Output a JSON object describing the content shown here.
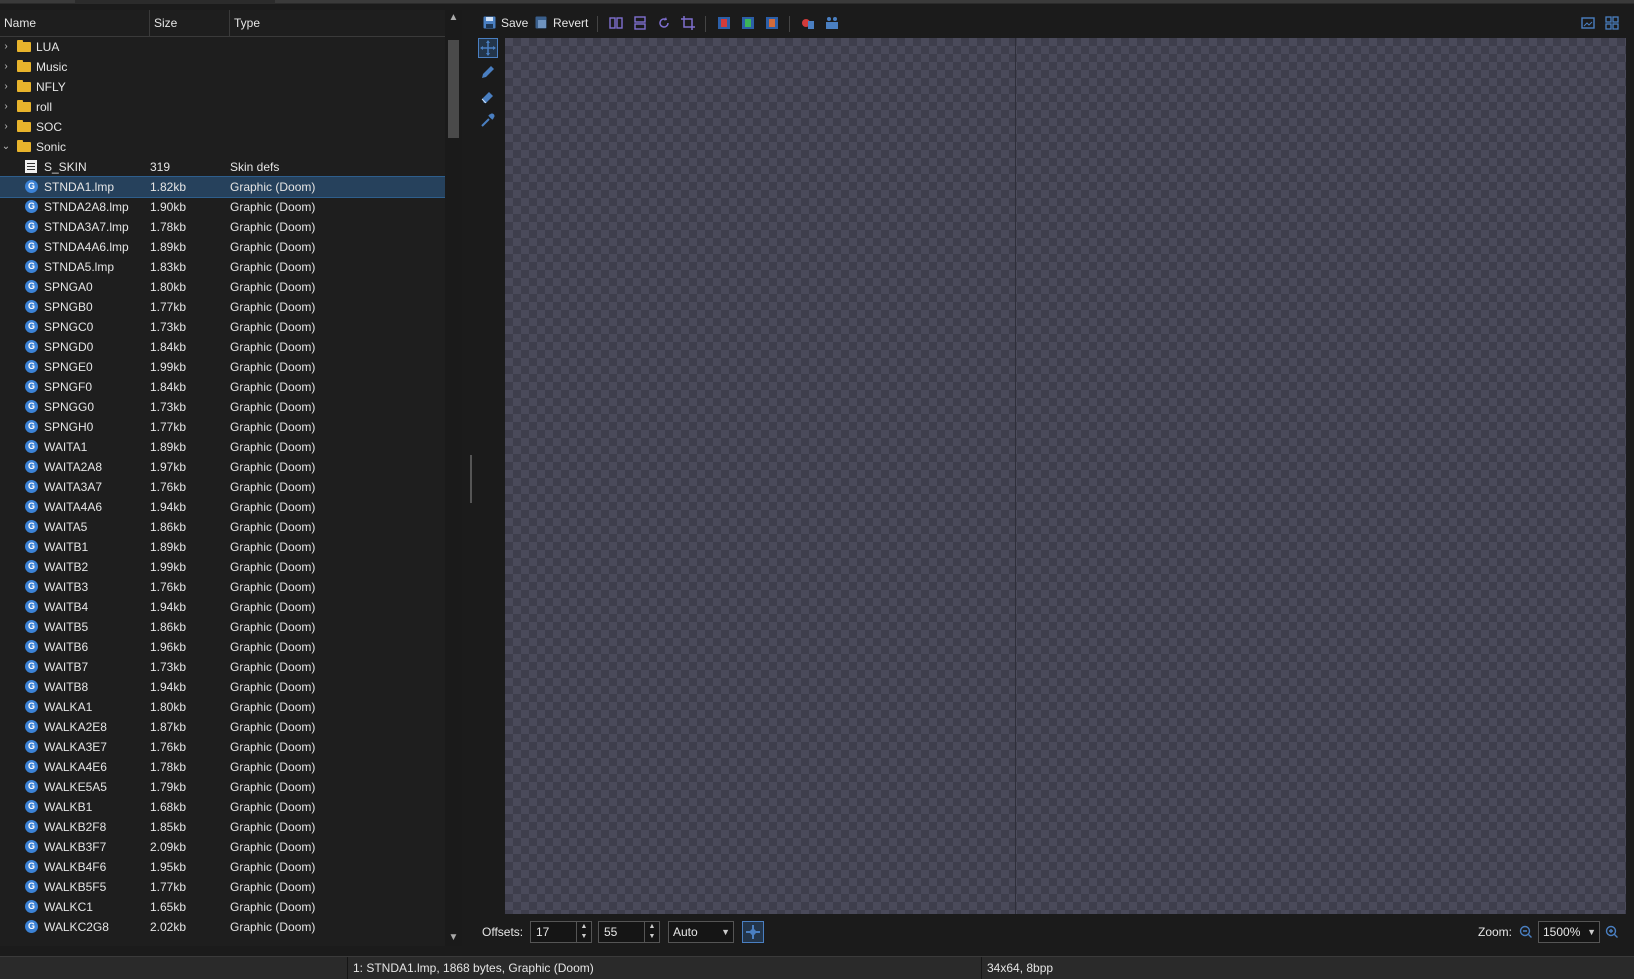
{
  "columns": {
    "name": "Name",
    "size": "Size",
    "type": "Type"
  },
  "tree": [
    {
      "kind": "folder",
      "expanded": false,
      "name": "LUA",
      "size": "",
      "type": ""
    },
    {
      "kind": "folder",
      "expanded": false,
      "name": "Music",
      "size": "",
      "type": ""
    },
    {
      "kind": "folder",
      "expanded": false,
      "name": "NFLY",
      "size": "",
      "type": ""
    },
    {
      "kind": "folder",
      "expanded": false,
      "name": "roll",
      "size": "",
      "type": ""
    },
    {
      "kind": "folder",
      "expanded": false,
      "name": "SOC",
      "size": "",
      "type": ""
    },
    {
      "kind": "folder",
      "expanded": true,
      "name": "Sonic",
      "size": "",
      "type": ""
    },
    {
      "kind": "text",
      "name": "S_SKIN",
      "size": "319",
      "type": "Skin defs"
    },
    {
      "kind": "graphic",
      "selected": true,
      "name": "STNDA1.lmp",
      "size": "1.82kb",
      "type": "Graphic (Doom)"
    },
    {
      "kind": "graphic",
      "name": "STNDA2A8.lmp",
      "size": "1.90kb",
      "type": "Graphic (Doom)"
    },
    {
      "kind": "graphic",
      "name": "STNDA3A7.lmp",
      "size": "1.78kb",
      "type": "Graphic (Doom)"
    },
    {
      "kind": "graphic",
      "name": "STNDA4A6.lmp",
      "size": "1.89kb",
      "type": "Graphic (Doom)"
    },
    {
      "kind": "graphic",
      "name": "STNDA5.lmp",
      "size": "1.83kb",
      "type": "Graphic (Doom)"
    },
    {
      "kind": "graphic",
      "name": "SPNGA0",
      "size": "1.80kb",
      "type": "Graphic (Doom)"
    },
    {
      "kind": "graphic",
      "name": "SPNGB0",
      "size": "1.77kb",
      "type": "Graphic (Doom)"
    },
    {
      "kind": "graphic",
      "name": "SPNGC0",
      "size": "1.73kb",
      "type": "Graphic (Doom)"
    },
    {
      "kind": "graphic",
      "name": "SPNGD0",
      "size": "1.84kb",
      "type": "Graphic (Doom)"
    },
    {
      "kind": "graphic",
      "name": "SPNGE0",
      "size": "1.99kb",
      "type": "Graphic (Doom)"
    },
    {
      "kind": "graphic",
      "name": "SPNGF0",
      "size": "1.84kb",
      "type": "Graphic (Doom)"
    },
    {
      "kind": "graphic",
      "name": "SPNGG0",
      "size": "1.73kb",
      "type": "Graphic (Doom)"
    },
    {
      "kind": "graphic",
      "name": "SPNGH0",
      "size": "1.77kb",
      "type": "Graphic (Doom)"
    },
    {
      "kind": "graphic",
      "name": "WAITA1",
      "size": "1.89kb",
      "type": "Graphic (Doom)"
    },
    {
      "kind": "graphic",
      "name": "WAITA2A8",
      "size": "1.97kb",
      "type": "Graphic (Doom)"
    },
    {
      "kind": "graphic",
      "name": "WAITA3A7",
      "size": "1.76kb",
      "type": "Graphic (Doom)"
    },
    {
      "kind": "graphic",
      "name": "WAITA4A6",
      "size": "1.94kb",
      "type": "Graphic (Doom)"
    },
    {
      "kind": "graphic",
      "name": "WAITA5",
      "size": "1.86kb",
      "type": "Graphic (Doom)"
    },
    {
      "kind": "graphic",
      "name": "WAITB1",
      "size": "1.89kb",
      "type": "Graphic (Doom)"
    },
    {
      "kind": "graphic",
      "name": "WAITB2",
      "size": "1.99kb",
      "type": "Graphic (Doom)"
    },
    {
      "kind": "graphic",
      "name": "WAITB3",
      "size": "1.76kb",
      "type": "Graphic (Doom)"
    },
    {
      "kind": "graphic",
      "name": "WAITB4",
      "size": "1.94kb",
      "type": "Graphic (Doom)"
    },
    {
      "kind": "graphic",
      "name": "WAITB5",
      "size": "1.86kb",
      "type": "Graphic (Doom)"
    },
    {
      "kind": "graphic",
      "name": "WAITB6",
      "size": "1.96kb",
      "type": "Graphic (Doom)"
    },
    {
      "kind": "graphic",
      "name": "WAITB7",
      "size": "1.73kb",
      "type": "Graphic (Doom)"
    },
    {
      "kind": "graphic",
      "name": "WAITB8",
      "size": "1.94kb",
      "type": "Graphic (Doom)"
    },
    {
      "kind": "graphic",
      "name": "WALKA1",
      "size": "1.80kb",
      "type": "Graphic (Doom)"
    },
    {
      "kind": "graphic",
      "name": "WALKA2E8",
      "size": "1.87kb",
      "type": "Graphic (Doom)"
    },
    {
      "kind": "graphic",
      "name": "WALKA3E7",
      "size": "1.76kb",
      "type": "Graphic (Doom)"
    },
    {
      "kind": "graphic",
      "name": "WALKA4E6",
      "size": "1.78kb",
      "type": "Graphic (Doom)"
    },
    {
      "kind": "graphic",
      "name": "WALKE5A5",
      "size": "1.79kb",
      "type": "Graphic (Doom)"
    },
    {
      "kind": "graphic",
      "name": "WALKB1",
      "size": "1.68kb",
      "type": "Graphic (Doom)"
    },
    {
      "kind": "graphic",
      "name": "WALKB2F8",
      "size": "1.85kb",
      "type": "Graphic (Doom)"
    },
    {
      "kind": "graphic",
      "name": "WALKB3F7",
      "size": "2.09kb",
      "type": "Graphic (Doom)"
    },
    {
      "kind": "graphic",
      "name": "WALKB4F6",
      "size": "1.95kb",
      "type": "Graphic (Doom)"
    },
    {
      "kind": "graphic",
      "name": "WALKB5F5",
      "size": "1.77kb",
      "type": "Graphic (Doom)"
    },
    {
      "kind": "graphic",
      "name": "WALKC1",
      "size": "1.65kb",
      "type": "Graphic (Doom)"
    },
    {
      "kind": "graphic",
      "name": "WALKC2G8",
      "size": "2.02kb",
      "type": "Graphic (Doom)"
    }
  ],
  "toolbar": {
    "save_label": "Save",
    "revert_label": "Revert"
  },
  "offsets": {
    "label": "Offsets:",
    "x": "17",
    "y": "55",
    "mode": "Auto"
  },
  "zoom": {
    "label": "Zoom:",
    "value": "1500%"
  },
  "status": {
    "entry_info": "1: STNDA1.lmp, 1868 bytes, Graphic (Doom)",
    "image_info": "34x64, 8bpp"
  },
  "colors": {
    "accent": "#3b82d6",
    "selection": "#26415c",
    "folder": "#e8b42c"
  }
}
